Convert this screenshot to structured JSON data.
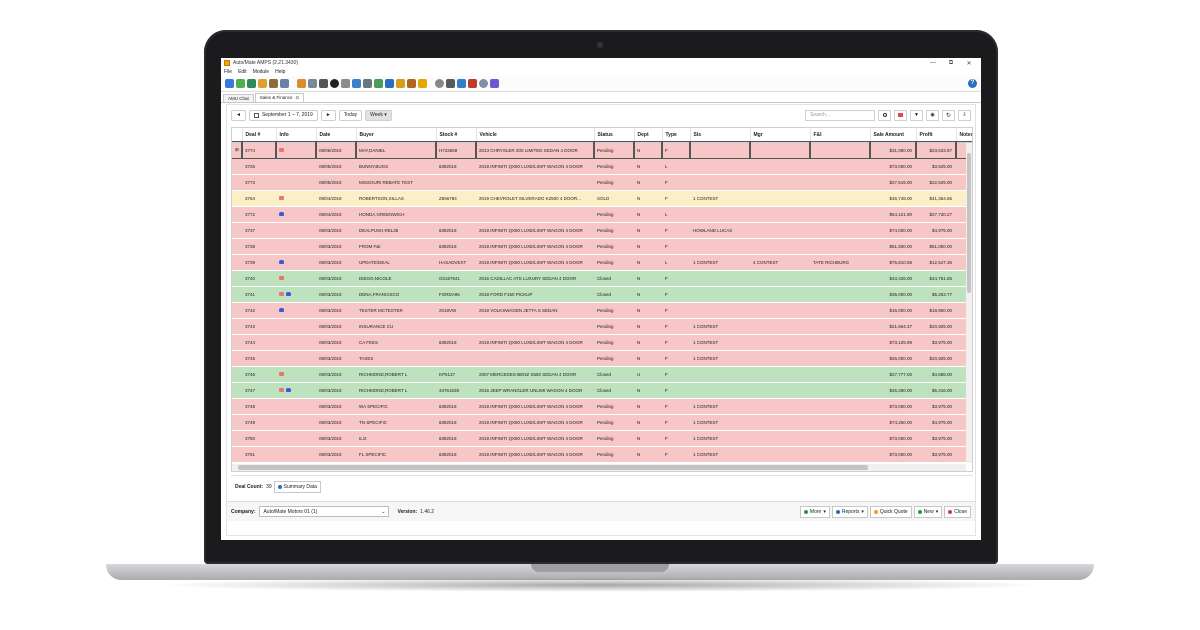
{
  "window": {
    "title": "Auto/Mate AMPS (2.21.3430)",
    "minimize": "—",
    "maximize": "⧉",
    "close": "✕"
  },
  "menu": [
    "File",
    "Edit",
    "Module",
    "Help"
  ],
  "tabs": [
    {
      "label": "AMU Chat"
    },
    {
      "label": "Sales & Finance",
      "close": "⊠"
    }
  ],
  "filters": {
    "prev": "◄",
    "date_range": "September 1 – 7, 2019",
    "next": "►",
    "today": "Today",
    "view": "Week ▾",
    "search_placeholder": "Search..."
  },
  "columns": [
    "Deal #",
    "Info",
    "Date",
    "Buyer",
    "Stock #",
    "Vehicle",
    "Status",
    "Dept",
    "Type",
    "Sls",
    "Mgr",
    "F&I",
    "Sale Amount",
    "Profit",
    "Notes"
  ],
  "rows": [
    {
      "deal": "3774",
      "info": [
        "lock"
      ],
      "date": "09/06/2019",
      "buyer": "MAY,DANIEL",
      "stock": "H743669",
      "vehicle": "2013 CHRYSLER 300 LIMITED SEDAN 4 DOOR",
      "status": "Pending",
      "dept": "N",
      "type": "F",
      "sls": "",
      "mgr": "",
      "fi": "",
      "sale": "$31,080.00",
      "profit": "$23,633.57",
      "color": "pink",
      "selected": true
    },
    {
      "deal": "3726",
      "info": [],
      "date": "09/05/2019",
      "buyer": "BUNNY,BUGS",
      "stock": "8382019",
      "vehicle": "2019 INFINITI QX80 LUXE/LIMIT WAGON 4 DOOR",
      "status": "Pending",
      "dept": "N",
      "type": "L",
      "sls": "",
      "mgr": "",
      "fi": "",
      "sale": "$73,000.00",
      "profit": "$3,525.00",
      "color": "pink"
    },
    {
      "deal": "3773",
      "info": [],
      "date": "09/05/2019",
      "buyer": "MISSOURI REBATE TEST",
      "stock": "",
      "vehicle": "",
      "status": "Pending",
      "dept": "N",
      "type": "F",
      "sls": "",
      "mgr": "",
      "fi": "",
      "sale": "$27,515.00",
      "profit": "$22,525.00",
      "color": "pink"
    },
    {
      "deal": "3764",
      "info": [
        "lock"
      ],
      "date": "09/04/2019",
      "buyer": "ROBERTSON,SILLAS",
      "stock": "Z556784",
      "vehicle": "2019 CHEVROLET SILVERADO K2500 4 DOOR...",
      "status": "SOLD",
      "dept": "N",
      "type": "F",
      "sls": "1 CONTEST",
      "mgr": "",
      "fi": "",
      "sale": "$46,748.00",
      "profit": "$41,364.65",
      "color": "yellow"
    },
    {
      "deal": "3772",
      "info": [
        "car"
      ],
      "date": "09/04/2019",
      "buyer": "HONDA,GREENWICH",
      "stock": "",
      "vehicle": "",
      "status": "Pending",
      "dept": "N",
      "type": "L",
      "sls": "",
      "mgr": "",
      "fi": "",
      "sale": "$54,121.90",
      "profit": "$27,730.27",
      "color": "pink"
    },
    {
      "deal": "3737",
      "info": [],
      "date": "09/03/2019",
      "buyer": "DEALPUSH,REL35",
      "stock": "8382019",
      "vehicle": "2019 INFINITI QX80 LUXE/LIMIT WAGON 4 DOOR",
      "status": "Pending",
      "dept": "N",
      "type": "F",
      "sls": "HOWLAND LUCAS",
      "mgr": "",
      "fi": "",
      "sale": "$74,000.00",
      "profit": "$4,975.00",
      "color": "pink"
    },
    {
      "deal": "3738",
      "info": [],
      "date": "09/03/2019",
      "buyer": "FROM F&I",
      "stock": "8382019",
      "vehicle": "2019 INFINITI QX80 LUXE/LIMIT WAGON 4 DOOR",
      "status": "Pending",
      "dept": "N",
      "type": "F",
      "sls": "",
      "mgr": "",
      "fi": "",
      "sale": "$51,500.00",
      "profit": "$51,050.00",
      "color": "pink"
    },
    {
      "deal": "3739",
      "info": [
        "car"
      ],
      "date": "09/03/2019",
      "buyer": "UPDATE\\DEAL",
      "stock": "HASADVEXT",
      "vehicle": "2019 INFINITI QX80 LUXE/LIMIT WAGON 4 DOOR",
      "status": "Pending",
      "dept": "N",
      "type": "L",
      "sls": "1 CONTEST",
      "mgr": "4 CONTEST",
      "fi": "TATE RICHBURG",
      "sale": "$75,810.58",
      "profit": "$12,547.36",
      "color": "pink"
    },
    {
      "deal": "3740",
      "info": [
        "lock"
      ],
      "date": "09/03/2019",
      "buyer": "DIEGO,NICOLE",
      "stock": "G0167541",
      "vehicle": "2016 CADILLAC ATS LUXURY SEDAN 4 DOOR",
      "status": "Closed",
      "dept": "N",
      "type": "F",
      "sls": "",
      "mgr": "",
      "fi": "",
      "sale": "$43,426.00",
      "profit": "$44,761.65",
      "color": "green"
    },
    {
      "deal": "3741",
      "info": [
        "lock",
        "car"
      ],
      "date": "09/03/2019",
      "buyer": "DENA,FRANCISCO",
      "stock": "FORDA95",
      "vehicle": "2018 FORD F150 PICKUP",
      "status": "Closed",
      "dept": "N",
      "type": "F",
      "sls": "",
      "mgr": "",
      "fi": "",
      "sale": "$35,000.00",
      "profit": "$5,253.77",
      "color": "green"
    },
    {
      "deal": "3742",
      "info": [
        "car"
      ],
      "date": "09/03/2019",
      "buyer": "TESTER MCTESTER",
      "stock": "2018VW",
      "vehicle": "2018 VOLKSWAGEN JETTA S SEDAN",
      "status": "Pending",
      "dept": "N",
      "type": "F",
      "sls": "",
      "mgr": "",
      "fi": "",
      "sale": "$16,000.00",
      "profit": "$18,950.00",
      "color": "pink"
    },
    {
      "deal": "3743",
      "info": [],
      "date": "09/03/2019",
      "buyer": "INSURANCE CU",
      "stock": "",
      "vehicle": "",
      "status": "Pending",
      "dept": "N",
      "type": "F",
      "sls": "1 CONTEST",
      "mgr": "",
      "fi": "",
      "sale": "$21,664.37",
      "profit": "$20,925.00",
      "color": "pink"
    },
    {
      "deal": "3744",
      "info": [],
      "date": "09/03/2019",
      "buyer": "CA FEES",
      "stock": "8382019",
      "vehicle": "2019 INFINITI QX80 LUXE/LIMIT WAGON 4 DOOR",
      "status": "Pending",
      "dept": "N",
      "type": "F",
      "sls": "1 CONTEST",
      "mgr": "",
      "fi": "",
      "sale": "$73,125.99",
      "profit": "$3,975.00",
      "color": "pink"
    },
    {
      "deal": "3745",
      "info": [],
      "date": "09/03/2019",
      "buyer": "TAXES",
      "stock": "",
      "vehicle": "",
      "status": "Pending",
      "dept": "N",
      "type": "F",
      "sls": "1 CONTEST",
      "mgr": "",
      "fi": "",
      "sale": "$26,000.00",
      "profit": "$20,925.00",
      "color": "pink"
    },
    {
      "deal": "3746",
      "info": [
        "lock"
      ],
      "date": "09/03/2019",
      "buyer": "RICHMOND,ROBERT L",
      "stock": "KP5137",
      "vehicle": "2007 MERCEDES-BENZ S550 SEDAN 4 DOOR",
      "status": "Closed",
      "dept": "U",
      "type": "F",
      "sls": "",
      "mgr": "",
      "fi": "",
      "sale": "$27,777.00",
      "profit": "$4,888.00",
      "color": "green"
    },
    {
      "deal": "3747",
      "info": [
        "lock",
        "car"
      ],
      "date": "09/03/2019",
      "buyer": "RICHMOND,ROBERT L",
      "stock": "34761638",
      "vehicle": "2016 JEEP WRANGLER UNLIMI WAGON 4 DOOR",
      "status": "Closed",
      "dept": "N",
      "type": "F",
      "sls": "",
      "mgr": "",
      "fi": "",
      "sale": "$46,280.00",
      "profit": "$6,416.00",
      "color": "green"
    },
    {
      "deal": "3748",
      "info": [],
      "date": "09/03/2019",
      "buyer": "WA SPECIFIC",
      "stock": "8382019",
      "vehicle": "2019 INFINITI QX80 LUXE/LIMIT WAGON 4 DOOR",
      "status": "Pending",
      "dept": "N",
      "type": "F",
      "sls": "1 CONTEST",
      "mgr": "",
      "fi": "",
      "sale": "$73,000.00",
      "profit": "$3,975.00",
      "color": "pink"
    },
    {
      "deal": "3749",
      "info": [],
      "date": "09/03/2019",
      "buyer": "TN SPECIFIC",
      "stock": "8382019",
      "vehicle": "2019 INFINITI QX80 LUXE/LIMIT WAGON 4 DOOR",
      "status": "Pending",
      "dept": "N",
      "type": "F",
      "sls": "1 CONTEST",
      "mgr": "",
      "fi": "",
      "sale": "$74,250.00",
      "profit": "$4,975.00",
      "color": "pink"
    },
    {
      "deal": "3750",
      "info": [],
      "date": "09/03/2019",
      "buyer": "IL/2",
      "stock": "8382019",
      "vehicle": "2019 INFINITI QX80 LUXE/LIMIT WAGON 4 DOOR",
      "status": "Pending",
      "dept": "N",
      "type": "F",
      "sls": "1 CONTEST",
      "mgr": "",
      "fi": "",
      "sale": "$73,000.00",
      "profit": "$3,975.00",
      "color": "pink"
    },
    {
      "deal": "3751",
      "info": [],
      "date": "09/03/2019",
      "buyer": "FL SPECIFIC",
      "stock": "8382019",
      "vehicle": "2019 INFINITI QX80 LUXE/LIMIT WAGON 4 DOOR",
      "status": "Pending",
      "dept": "N",
      "type": "F",
      "sls": "1 CONTEST",
      "mgr": "",
      "fi": "",
      "sale": "$73,000.00",
      "profit": "$3,975.00",
      "color": "pink"
    }
  ],
  "deal_count_label": "Deal Count:",
  "deal_count": "39",
  "summary_button": "Summary Data",
  "company_label": "Company:",
  "company_value": "Auto/Mate Motors 01 (1)",
  "version_label": "Version:",
  "version_value": "1.46.2",
  "actions": [
    {
      "label": "More",
      "caret": "▾",
      "color": "#2a9d3a"
    },
    {
      "label": "Reports",
      "caret": "▾",
      "color": "#2b6cc4"
    },
    {
      "label": "Quick Quote",
      "caret": "",
      "color": "#e8a317"
    },
    {
      "label": "New",
      "caret": "▾",
      "color": "#2a9d3a"
    },
    {
      "label": "Close",
      "caret": "",
      "color": "#d63a3a"
    }
  ],
  "row_colors": {
    "pink": "#f7c7c7",
    "green": "#bde2bd",
    "yellow": "#fbefc7"
  }
}
